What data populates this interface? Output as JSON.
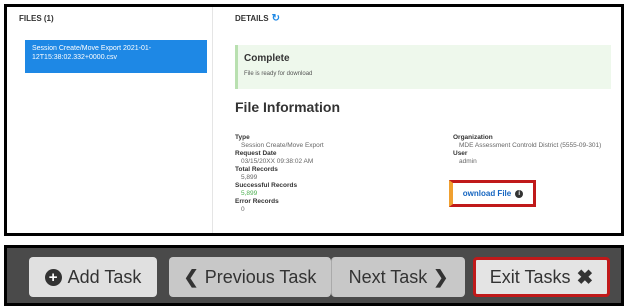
{
  "files_pane": {
    "header": "FILES (1)",
    "items": [
      {
        "label": "Session Create/Move Export 2021-01-12T15:38:02.332+0000.csv"
      }
    ]
  },
  "details": {
    "header": "DETAILS",
    "refresh_icon": "↻",
    "status": {
      "title": "Complete",
      "text": "File is ready for download"
    },
    "info_title": "File Information",
    "fields": {
      "type_label": "Type",
      "type_value": "Session Create/Move Export",
      "request_date_label": "Request Date",
      "request_date_value": "03/15/20XX 09:38:02 AM",
      "total_records_label": "Total Records",
      "total_records_value": "5,899",
      "successful_records_label": "Successful Records",
      "successful_records_value": "5,899",
      "error_records_label": "Error Records",
      "error_records_value": "0",
      "organization_label": "Organization",
      "organization_value": "MDE Assessment Controld District (5555-09-301)",
      "user_label": "User",
      "user_value": "admin"
    },
    "download_button": {
      "label": "ownload File",
      "icon": "info-icon"
    }
  },
  "toolbar": {
    "add_task": {
      "label": "Add Task",
      "icon": "plus-circle-icon"
    },
    "previous_task": {
      "label": "Previous Task",
      "icon": "chevron-left-icon"
    },
    "next_task": {
      "label": "Next Task",
      "icon": "chevron-right-icon"
    },
    "exit_tasks": {
      "label": "Exit Tasks",
      "icon": "close-icon"
    }
  },
  "colors": {
    "accent": "#1e88e5",
    "highlight_red": "#c0191a",
    "success_bg": "#eef8ec",
    "toolbar_bg": "#4a4a4a"
  }
}
